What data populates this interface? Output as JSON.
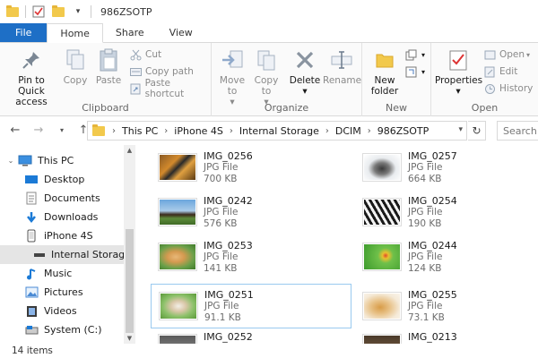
{
  "window": {
    "title": "986ZSOTP"
  },
  "tabs": {
    "file": "File",
    "home": "Home",
    "share": "Share",
    "view": "View"
  },
  "ribbon": {
    "clipboard": {
      "label": "Clipboard",
      "pin": "Pin to Quick access",
      "copy": "Copy",
      "paste": "Paste",
      "cut": "Cut",
      "copy_path": "Copy path",
      "paste_shortcut": "Paste shortcut"
    },
    "organize": {
      "label": "Organize",
      "move_to": "Move to",
      "copy_to": "Copy to",
      "delete": "Delete",
      "rename": "Rename"
    },
    "new": {
      "label": "New",
      "new_folder": "New folder"
    },
    "open": {
      "label": "Open",
      "properties": "Properties",
      "open": "Open",
      "edit": "Edit",
      "history": "History"
    }
  },
  "address": {
    "crumbs": [
      "This PC",
      "iPhone 4S",
      "Internal Storage",
      "DCIM",
      "986ZSOTP"
    ],
    "search_placeholder": "Search 9"
  },
  "nav": {
    "items": [
      {
        "label": "This PC"
      },
      {
        "label": "Desktop"
      },
      {
        "label": "Documents"
      },
      {
        "label": "Downloads"
      },
      {
        "label": "iPhone 4S"
      },
      {
        "label": "Internal Storage"
      },
      {
        "label": "Music"
      },
      {
        "label": "Pictures"
      },
      {
        "label": "Videos"
      },
      {
        "label": "System (C:)"
      }
    ]
  },
  "files": [
    {
      "name": "IMG_0256",
      "type": "JPG File",
      "size": "700 KB",
      "thumb": "tiger"
    },
    {
      "name": "IMG_0257",
      "type": "JPG File",
      "size": "664 KB",
      "thumb": "husky"
    },
    {
      "name": "IMG_0242",
      "type": "JPG File",
      "size": "576 KB",
      "thumb": "horse"
    },
    {
      "name": "IMG_0254",
      "type": "JPG File",
      "size": "190 KB",
      "thumb": "zebra"
    },
    {
      "name": "IMG_0253",
      "type": "JPG File",
      "size": "141 KB",
      "thumb": "puppy"
    },
    {
      "name": "IMG_0244",
      "type": "JPG File",
      "size": "124 KB",
      "thumb": "bird"
    },
    {
      "name": "IMG_0251",
      "type": "JPG File",
      "size": "91.1 KB",
      "thumb": "dog"
    },
    {
      "name": "IMG_0255",
      "type": "JPG File",
      "size": "73.1 KB",
      "thumb": "retriever"
    },
    {
      "name": "IMG_0252",
      "type": "",
      "size": "",
      "thumb": "partial"
    },
    {
      "name": "IMG_0213",
      "type": "",
      "size": "",
      "thumb": "partial"
    }
  ],
  "status": {
    "count": "14 items"
  }
}
